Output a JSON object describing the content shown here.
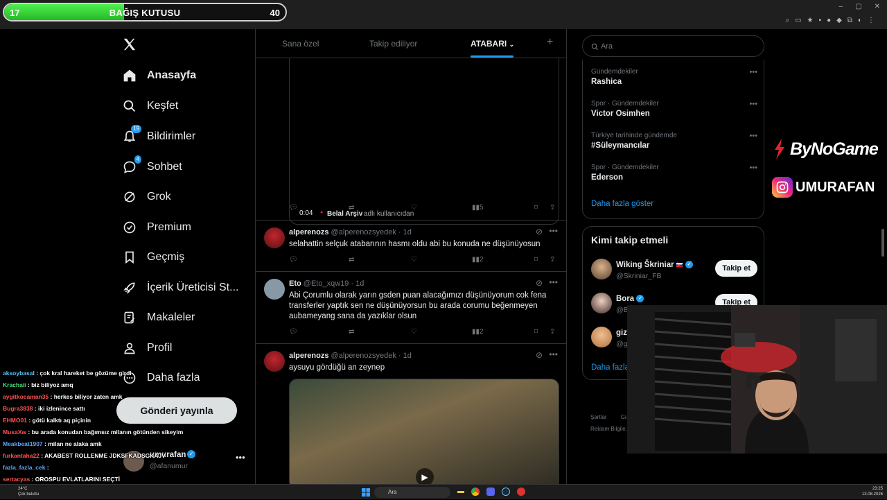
{
  "donation": {
    "current": "17",
    "title": "BAĞIŞ KUTUSU",
    "goal": "40",
    "progress_fraction": 0.425
  },
  "browser": {
    "url": "x.com/home"
  },
  "nav": {
    "items": [
      {
        "label": "Anasayfa"
      },
      {
        "label": "Keşfet"
      },
      {
        "label": "Bildirimler",
        "badge": "19"
      },
      {
        "label": "Sohbet",
        "badge": "4"
      },
      {
        "label": "Grok"
      },
      {
        "label": "Premium"
      },
      {
        "label": "Geçmiş"
      },
      {
        "label": "İçerik Üreticisi St..."
      },
      {
        "label": "Makaleler"
      },
      {
        "label": "Profil"
      },
      {
        "label": "Daha fazla"
      }
    ],
    "post_button": "Gönderi yayınla",
    "account": {
      "name": "umurafan",
      "handle": "@afanumur"
    }
  },
  "tabs": {
    "for_you": "Sana özel",
    "following": "Takip ediliyor",
    "list": "ATABARI",
    "add": "+"
  },
  "video": {
    "time": "0:04",
    "source_name": "Belal Arşiv",
    "source_suffix": "adlı kullanıcıdan",
    "views": "5"
  },
  "tweets": [
    {
      "name": "alperenozs",
      "handle": "@alperenozsyedek",
      "time": "1d",
      "text": "selahattin selçuk atabarının hasmı oldu abi bu konuda ne düşünüyosun",
      "views": "2"
    },
    {
      "name": "Eto",
      "handle": "@Eto_xqw19",
      "time": "1d",
      "text": "Abi Çorumlu olarak yarın gsden puan alacağımızı düşünüyorum cok fena transferler yaptık sen ne düşünüyorsun bu arada corumu beğenmeyen aubameyang sana da yazıklar olsun",
      "views": "2"
    },
    {
      "name": "alperenozs",
      "handle": "@alperenozsyedek",
      "time": "1d",
      "text": "aysuyu gördüğü an zeynep"
    }
  ],
  "search": {
    "placeholder": "Ara"
  },
  "trends": [
    {
      "context": "Gündemdekiler",
      "name": "Rashica"
    },
    {
      "context": "Spor · Gündemdekiler",
      "name": "Victor Osimhen"
    },
    {
      "context": "Türkiye tarihinde gündemde",
      "name": "#Süleymancılar"
    },
    {
      "context": "Spor · Gündemdekiler",
      "name": "Ederson"
    }
  ],
  "trends_more": "Daha fazla göster",
  "who_to_follow": {
    "title": "Kimi takip etmeli",
    "users": [
      {
        "name": "Wiking Škriniar",
        "handle": "@Skriniar_FB",
        "button": "Takip et"
      },
      {
        "name": "Bora",
        "handle": "@B...",
        "button": "Takip et"
      },
      {
        "name": "giz",
        "handle": "@g..."
      }
    ],
    "more": "Daha fazla"
  },
  "footer": {
    "line1a": "Şartlar",
    "line1b": "Gi...",
    "line2": "Reklam Bilgile..."
  },
  "overlay": {
    "brand": "ByNoGame",
    "instagram": "UMURAFAN"
  },
  "chat": [
    {
      "user": "aksoybasal",
      "user_color": "#4fc3f7",
      "msg": "çok kral hareket be gözüme girdi"
    },
    {
      "user": "Krachaii",
      "user_color": "#4ade80",
      "msg": "biz biliyoz amq"
    },
    {
      "user": "aygitkocaman35",
      "user_color": "#ff5252",
      "msg": "herkes biliyor zaten amk"
    },
    {
      "user": "Bugra3838",
      "user_color": "#ff5252",
      "msg": "iki izlenince sattı"
    },
    {
      "user": "EHMO01",
      "user_color": "#ff5252",
      "msg": "götü kalktı aq piçinin"
    },
    {
      "user": "MusaXw",
      "user_color": "#ff5252",
      "msg": "bu arada konudan bağımsız milanın götünden sikeyim"
    },
    {
      "user": "Meakbeat1907",
      "user_color": "#60a5fa",
      "msg": "milan ne alaka amk"
    },
    {
      "user": "furkantaha22",
      "user_color": "#ff5252",
      "msg": "AKABEST ROLLENME JDKSFKADSGKAJV"
    },
    {
      "user": "fazla_fazla_cek",
      "user_color": "#60a5fa",
      "msg": ""
    },
    {
      "user": "sertacyas",
      "user_color": "#ff5252",
      "msg": "OROSPU EVLATLARINI SEÇTİ"
    }
  ],
  "taskbar": {
    "weather_temp": "24°C",
    "weather_desc": "Çok bulutlu",
    "search": "Ara",
    "time": "23:25",
    "date": "13.08.2026"
  },
  "colors": {
    "accent": "#1d9bf0",
    "donation_fill": "#27b827",
    "background": "#000000"
  }
}
